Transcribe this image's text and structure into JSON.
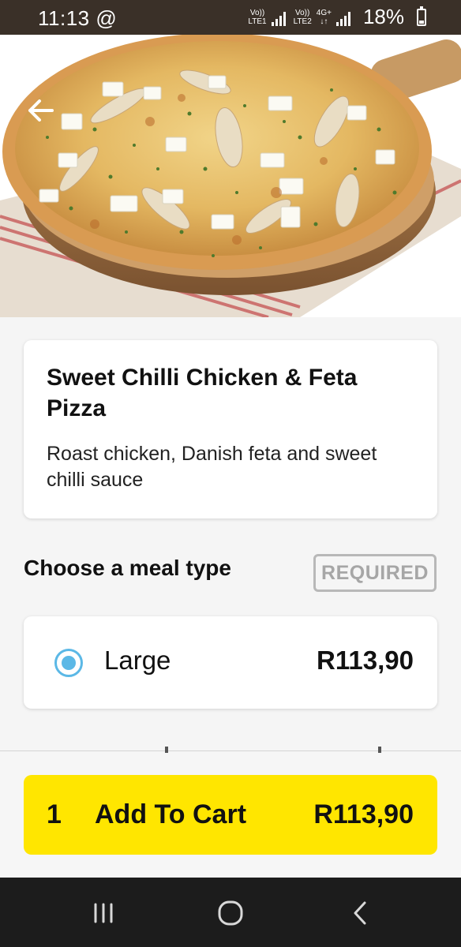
{
  "status_bar": {
    "time": "11:13",
    "at_icon": "@",
    "sim1_label_top": "Vo))",
    "sim1_label_bottom": "LTE1",
    "sim2_label_top": "Vo))",
    "sim2_label_bottom": "LTE2",
    "network_top": "4G+",
    "network_bottom": "↓↑",
    "battery": "18%"
  },
  "hero": {
    "image_icon": "pizza-photo",
    "back_icon": "arrow-left-icon"
  },
  "product": {
    "title": "Sweet Chilli Chicken & Feta Pizza",
    "description": "Roast chicken, Danish feta and sweet chilli sauce"
  },
  "meal_type": {
    "heading": "Choose a meal type",
    "badge": "REQUIRED",
    "options": [
      {
        "label": "Large",
        "price": "R113,90",
        "selected": true
      }
    ]
  },
  "cart": {
    "quantity": "1",
    "label": "Add To Cart",
    "price": "R113,90",
    "color": "#ffe600"
  },
  "nav": {
    "recent_icon": "recent-apps-icon",
    "home_icon": "home-icon",
    "back_icon": "back-icon"
  },
  "colors": {
    "accent": "#5bb8e6",
    "button": "#ffe600",
    "status_bar": "#3a3028",
    "nav_bar": "#1c1c1c"
  }
}
